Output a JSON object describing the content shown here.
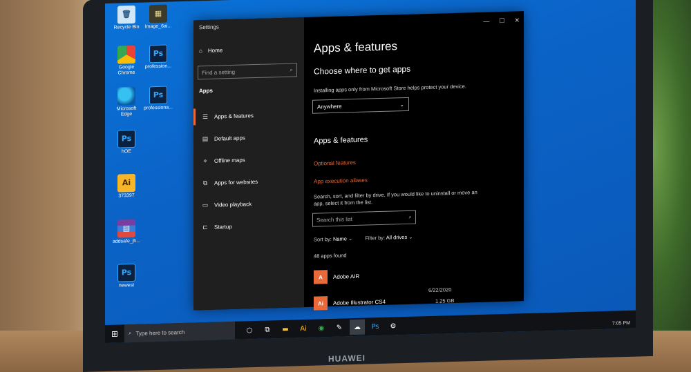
{
  "desktop_icons": [
    {
      "label": "Recycle Bin",
      "glyph": "🗑",
      "cls": "g-bin"
    },
    {
      "label": "Image_6ai...",
      "glyph": "▦",
      "cls": "g-img"
    },
    {
      "label": "Google Chrome",
      "glyph": "",
      "cls": "g-chrome"
    },
    {
      "label": "profession...",
      "glyph": "Ps",
      "cls": "g-ps"
    },
    {
      "label": "Microsoft Edge",
      "glyph": "",
      "cls": "g-edge"
    },
    {
      "label": "professiona...",
      "glyph": "Ps",
      "cls": "g-ps"
    },
    {
      "label": "hOE",
      "glyph": "Ps",
      "cls": "g-ps"
    },
    {
      "label": "373397",
      "glyph": "Ai",
      "cls": "g-ai"
    },
    {
      "label": "addsafe_jh...",
      "glyph": "▤",
      "cls": "g-rar"
    },
    {
      "label": "newest",
      "glyph": "Ps",
      "cls": "g-ps"
    }
  ],
  "settings": {
    "window_title": "Settings",
    "home": "Home",
    "search_placeholder": "Find a setting",
    "section": "Apps",
    "nav": [
      {
        "label": "Apps & features",
        "icon": "☰"
      },
      {
        "label": "Default apps",
        "icon": "▤"
      },
      {
        "label": "Offline maps",
        "icon": "⌖"
      },
      {
        "label": "Apps for websites",
        "icon": "⧉"
      },
      {
        "label": "Video playback",
        "icon": "▭"
      },
      {
        "label": "Startup",
        "icon": "⊏"
      }
    ],
    "window_controls": {
      "minimize": "—",
      "maximize": "☐",
      "close": "✕"
    },
    "page_title": "Apps & features",
    "choose_heading": "Choose where to get apps",
    "choose_desc": "Installing apps only from Microsoft Store helps protect your device.",
    "choose_value": "Anywhere",
    "apps_heading": "Apps & features",
    "link_optional": "Optional features",
    "link_aliases": "App execution aliases",
    "filter_desc": "Search, sort, and filter by drive. If you would like to uninstall or move an app, select it from the list.",
    "search_list_placeholder": "Search this list",
    "sort_label": "Sort by:",
    "sort_value": "Name",
    "filter_label": "Filter by:",
    "filter_value": "All drives",
    "apps_found": "48 apps found",
    "apps": [
      {
        "name": "Adobe AIR",
        "date": "",
        "size": ""
      },
      {
        "name": "Adobe Illustrator CS4",
        "date": "6/22/2020",
        "size": "1.25 GB"
      }
    ]
  },
  "taskbar": {
    "start": "⊞",
    "search_placeholder": "Type here to search",
    "clock": "7:05 PM"
  },
  "laptop_brand": "HUAWEI"
}
